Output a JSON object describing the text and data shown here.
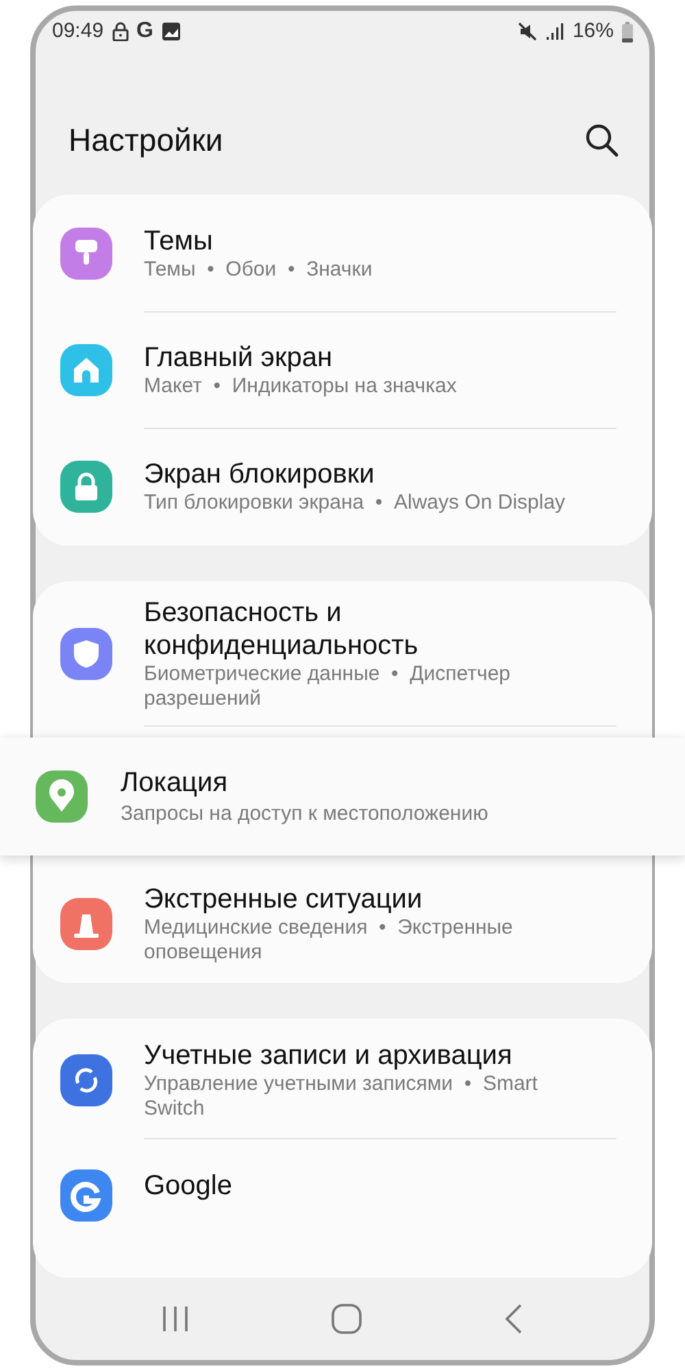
{
  "status_bar": {
    "time": "09:49",
    "notification_letter": "G",
    "battery": "16%"
  },
  "title": "Настройки",
  "groups": [
    {
      "items": [
        {
          "kind": "brush",
          "color": "#c27ee6",
          "title": "Темы",
          "subtitle": "Темы  •  Обои  •  Значки",
          "highlighted": false
        },
        {
          "kind": "home",
          "color": "#2ec0e6",
          "title": "Главный экран",
          "subtitle": "Макет  •  Индикаторы на значках",
          "highlighted": false
        },
        {
          "kind": "lock",
          "color": "#2fb39a",
          "title": "Экран блокировки",
          "subtitle": "Тип блокировки экрана  •  Always On Display",
          "highlighted": false
        }
      ]
    },
    {
      "items": [
        {
          "kind": "shield",
          "color": "#7a84f5",
          "title": "Безопасность и конфиденциальность",
          "subtitle": "Биометрические данные  •  Диспетчер разрешений",
          "highlighted": false
        },
        {
          "kind": "pin",
          "color": "#65b85c",
          "title": "Локация",
          "subtitle": "Запросы на доступ к местоположению",
          "highlighted": true
        },
        {
          "kind": "alert",
          "color": "#ef7265",
          "title": "Экстренные ситуации",
          "subtitle": "Медицинские сведения  •  Экстренные оповещения",
          "highlighted": false
        }
      ]
    },
    {
      "items": [
        {
          "kind": "sync",
          "color": "#3e72e0",
          "title": "Учетные записи и архивация",
          "subtitle": "Управление учетными записями  •  Smart Switch",
          "highlighted": false
        },
        {
          "kind": "google",
          "color": "#3e86f0",
          "title": "Google",
          "highlighted": false
        }
      ]
    }
  ]
}
